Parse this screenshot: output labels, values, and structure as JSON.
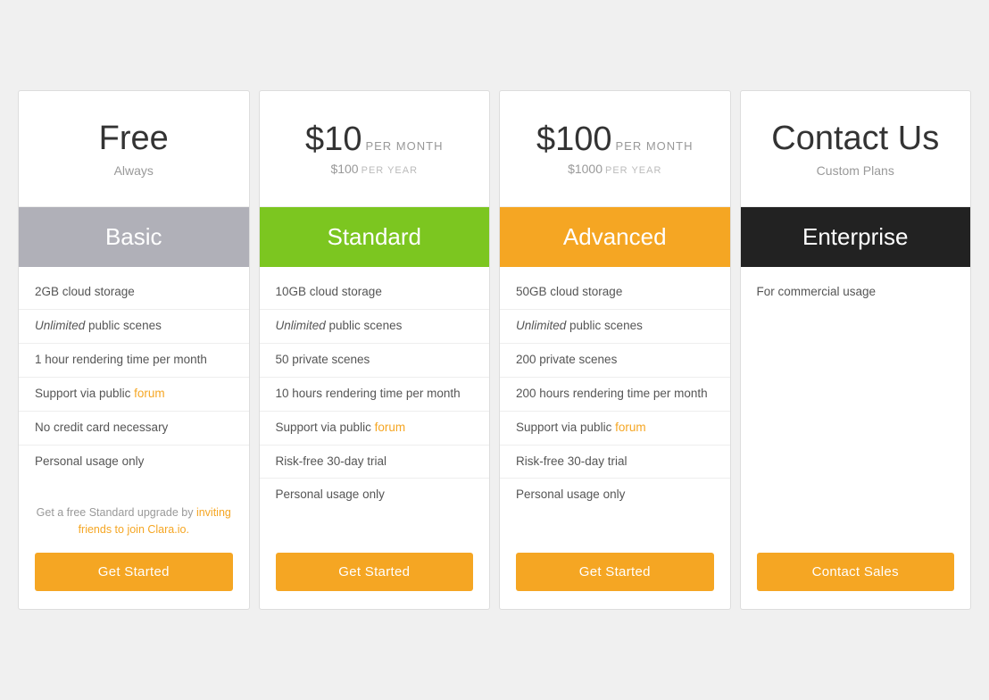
{
  "cards": [
    {
      "id": "free",
      "header": {
        "price_main": "Free",
        "price_is_free": true,
        "subtitle": "Always"
      },
      "tier": {
        "label": "Basic",
        "style": "tier-basic"
      },
      "features": [
        {
          "text": "2GB cloud storage",
          "has_italic": false,
          "has_link": false
        },
        {
          "text_before": "",
          "italic_part": "Unlimited",
          "text_after": " public scenes",
          "has_italic": true,
          "has_link": false
        },
        {
          "text": "1 hour rendering time per month",
          "has_italic": false,
          "has_link": false
        },
        {
          "text_before": "Support via public ",
          "link_text": "forum",
          "text_after": "",
          "has_italic": false,
          "has_link": true
        },
        {
          "text": "No credit card necessary",
          "has_italic": false,
          "has_link": false
        },
        {
          "text": "Personal usage only",
          "has_italic": false,
          "has_link": false
        }
      ],
      "footer": {
        "note_text": "Get a free Standard upgrade by ",
        "note_link_text": "inviting friends to join Clara.io.",
        "note_link_href": "#",
        "has_note": true
      },
      "button_label": "Get Started"
    },
    {
      "id": "standard",
      "header": {
        "price_main": "$10",
        "per_month": "PER MONTH",
        "price_secondary": "$100",
        "per_year": "PER YEAR",
        "price_is_free": false
      },
      "tier": {
        "label": "Standard",
        "style": "tier-standard"
      },
      "features": [
        {
          "text": "10GB cloud storage",
          "has_italic": false,
          "has_link": false
        },
        {
          "text_before": "",
          "italic_part": "Unlimited",
          "text_after": " public scenes",
          "has_italic": true,
          "has_link": false
        },
        {
          "text": "50 private scenes",
          "has_italic": false,
          "has_link": false
        },
        {
          "text": "10 hours rendering time per month",
          "has_italic": false,
          "has_link": false
        },
        {
          "text_before": "Support via public ",
          "link_text": "forum",
          "text_after": "",
          "has_italic": false,
          "has_link": true
        },
        {
          "text": "Risk-free 30-day trial",
          "has_italic": false,
          "has_link": false
        },
        {
          "text": "Personal usage only",
          "has_italic": false,
          "has_link": false
        }
      ],
      "footer": {
        "has_note": false
      },
      "button_label": "Get Started"
    },
    {
      "id": "advanced",
      "header": {
        "price_main": "$100",
        "per_month": "PER MONTH",
        "price_secondary": "$1000",
        "per_year": "PER YEAR",
        "price_is_free": false
      },
      "tier": {
        "label": "Advanced",
        "style": "tier-advanced"
      },
      "features": [
        {
          "text": "50GB cloud storage",
          "has_italic": false,
          "has_link": false
        },
        {
          "text_before": "",
          "italic_part": "Unlimited",
          "text_after": " public scenes",
          "has_italic": true,
          "has_link": false
        },
        {
          "text": "200 private scenes",
          "has_italic": false,
          "has_link": false
        },
        {
          "text": "200 hours rendering time per month",
          "has_italic": false,
          "has_link": false
        },
        {
          "text_before": "Support via public ",
          "link_text": "forum",
          "text_after": "",
          "has_italic": false,
          "has_link": true
        },
        {
          "text": "Risk-free 30-day trial",
          "has_italic": false,
          "has_link": false
        },
        {
          "text": "Personal usage only",
          "has_italic": false,
          "has_link": false
        }
      ],
      "footer": {
        "has_note": false
      },
      "button_label": "Get Started"
    },
    {
      "id": "enterprise",
      "header": {
        "price_main": "Contact Us",
        "price_is_free": true,
        "subtitle": "Custom Plans"
      },
      "tier": {
        "label": "Enterprise",
        "style": "tier-enterprise"
      },
      "features": [
        {
          "text": "For commercial usage",
          "has_italic": false,
          "has_link": false
        }
      ],
      "footer": {
        "has_note": false
      },
      "button_label": "Contact Sales"
    }
  ]
}
